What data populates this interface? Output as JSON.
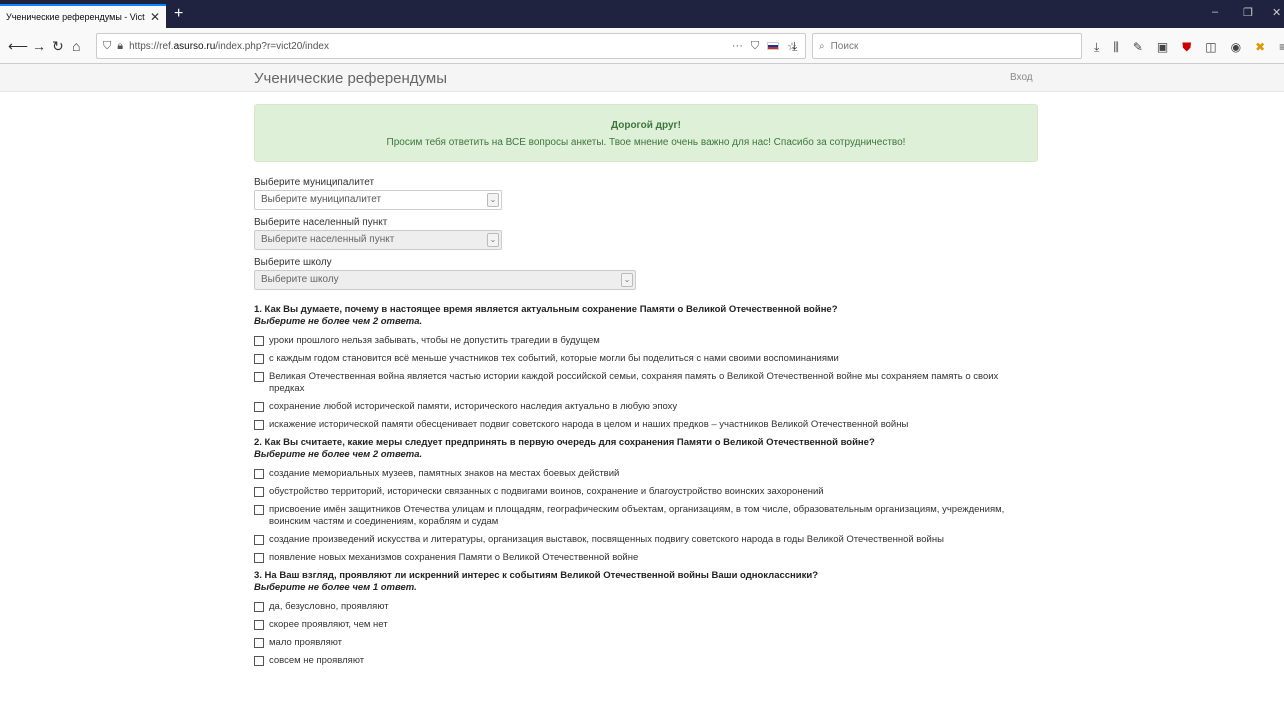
{
  "browser": {
    "tab_title": "Ученические референдумы - Vict",
    "tab_close": "✕",
    "new_tab": "+",
    "url_prefix": "https://ref.",
    "url_domain": "asurso.ru",
    "url_path": "/index.php?r=vict20/index",
    "search_placeholder": "Поиск",
    "window_minimize": "–",
    "window_maximize": "❐",
    "window_close": "✕"
  },
  "header": {
    "brand": "Ученические референдумы",
    "login": "Вход"
  },
  "alert": {
    "title": "Дорогой друг!",
    "text": "Просим тебя ответить на ВСЕ вопросы анкеты. Твое мнение очень важно для нас! Спасибо за сотрудничество!"
  },
  "filters": {
    "municipality": {
      "label": "Выберите муниципалитет",
      "value": "Выберите муниципалитет"
    },
    "settlement": {
      "label": "Выберите населенный пункт",
      "value": "Выберите населенный пункт"
    },
    "school": {
      "label": "Выберите школу",
      "value": "Выберите школу"
    }
  },
  "questions": [
    {
      "title": "1. Как Вы думаете, почему в настоящее время является актуальным сохранение Памяти о Великой Отечественной войне?",
      "subtitle": "Выберите не более чем 2 ответа.",
      "options": [
        "уроки прошлого нельзя забывать, чтобы не допустить трагедии в будущем",
        "с каждым годом становится всё меньше участников тех событий, которые могли бы поделиться с нами своими воспоминаниями",
        "Великая Отечественная война является частью истории каждой российской семьи, сохраняя память о Великой Отечественной войне мы сохраняем память о своих предках",
        "сохранение любой исторической памяти, исторического наследия актуально в любую эпоху",
        "искажение исторической памяти обесценивает подвиг советского народа в целом и наших предков – участников Великой Отечественной войны"
      ]
    },
    {
      "title": "2. Как Вы считаете, какие меры следует предпринять в первую очередь для сохранения Памяти о Великой Отечественной войне?",
      "subtitle": "Выберите не более чем 2 ответа.",
      "options": [
        "создание мемориальных музеев, памятных знаков на местах боевых действий",
        "обустройство территорий, исторически связанных с подвигами воинов, сохранение и благоустройство воинских захоронений",
        "присвоение имён защитников Отечества улицам и площадям, географическим объектам, организациям, в том числе, образовательным организациям, учреждениям, воинским частям и соединениям, кораблям и судам",
        "создание произведений искусства и литературы, организация выставок, посвященных подвигу советского народа в годы Великой Отечественной войны",
        "появление новых механизмов сохранения Памяти о Великой Отечественной войне"
      ]
    },
    {
      "title": "3. На Ваш взгляд, проявляют ли искренний интерес к событиям Великой Отечественной войны Ваши одноклассники?",
      "subtitle": "Выберите не более чем 1 ответ.",
      "options": [
        "да, безусловно, проявляют",
        "скорее проявляют, чем нет",
        "мало проявляют",
        "совсем не проявляют"
      ]
    }
  ]
}
